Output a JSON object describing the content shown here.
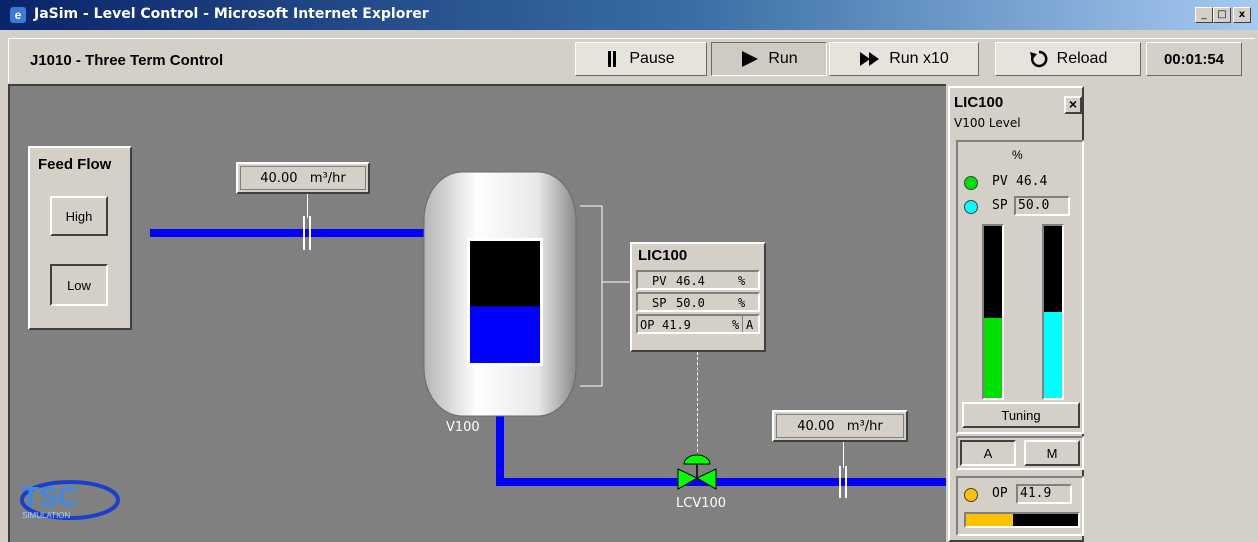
{
  "window": {
    "title": "JaSim - Level Control - Microsoft Internet Explorer",
    "min": "_",
    "max": "□",
    "close": "x"
  },
  "toolbar": {
    "title": "J1010 - Three Term Control",
    "pause": "Pause",
    "run": "Run",
    "run10": "Run x10",
    "reload": "Reload",
    "time": "00:01:54"
  },
  "feed": {
    "title": "Feed Flow",
    "high": "High",
    "low": "Low",
    "active": "Low"
  },
  "inflow": {
    "value": "40.00",
    "unit": "m³/hr"
  },
  "outflow": {
    "value": "40.00",
    "unit": "m³/hr"
  },
  "vessel": {
    "tag": "V100",
    "level_percent": 46.4
  },
  "valve": {
    "tag": "LCV100"
  },
  "controller": {
    "tag": "LIC100",
    "pv_label": "PV",
    "pv": "46.4",
    "sp_label": "SP",
    "sp": "50.0",
    "op_label": "OP",
    "op": "41.9",
    "unit": "%",
    "mode": "A"
  },
  "faceplate": {
    "tag": "LIC100",
    "close": "×",
    "desc": "V100 Level",
    "unit": "%",
    "pv_label": "PV",
    "pv": "46.4",
    "sp_label": "SP",
    "sp": "50.0",
    "pv_bar_percent": 46.4,
    "sp_bar_percent": 50.0,
    "tuning": "Tuning",
    "auto": "A",
    "manual": "M",
    "op_label": "OP",
    "op": "41.9",
    "op_bar_percent": 41.9
  },
  "logo": {
    "text": "TSC",
    "sub": "SIMULATION"
  },
  "colors": {
    "pipe": "#0000ff",
    "pv": "#00e000",
    "sp": "#00ffff",
    "op": "#ffc000",
    "valve": "#00ff00"
  }
}
